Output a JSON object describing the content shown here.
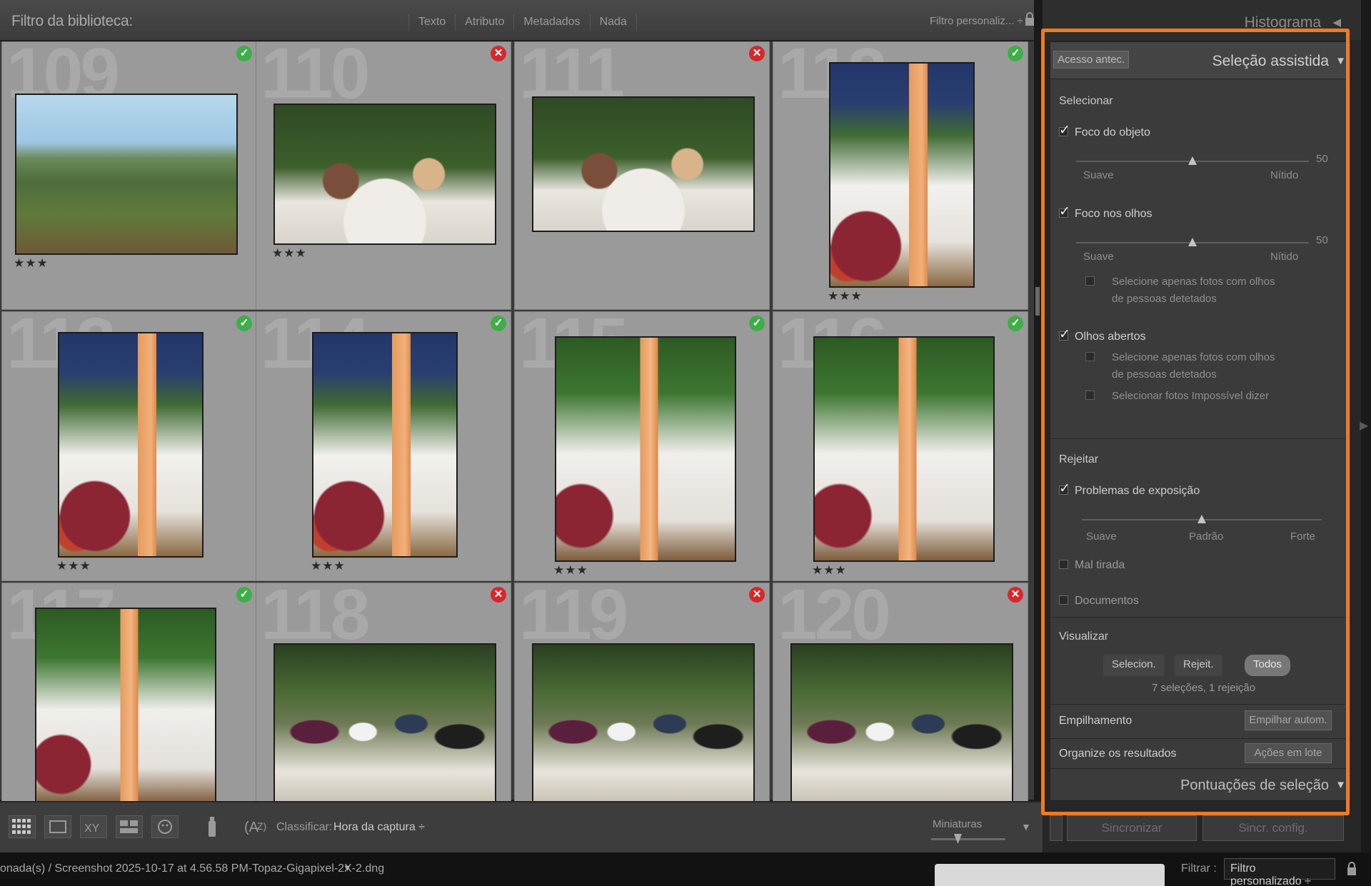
{
  "filterbar": {
    "title": "Filtro da biblioteca:",
    "tabs": [
      "Texto",
      "Atributo",
      "Metadados",
      "Nada"
    ],
    "preset": "Filtro personaliz... ÷"
  },
  "grid": {
    "cells": [
      {
        "num": "109",
        "flag": "pick",
        "stars": "★★★",
        "scene": "vineyard"
      },
      {
        "num": "110",
        "flag": "reject",
        "stars": "★★★",
        "scene": "table"
      },
      {
        "num": "111",
        "flag": "reject",
        "stars": "",
        "scene": "table"
      },
      {
        "num": "112",
        "flag": "pick",
        "stars": "★★★",
        "scene": "bottle"
      },
      {
        "num": "113",
        "flag": "pick",
        "stars": "★★★",
        "scene": "bottle"
      },
      {
        "num": "114",
        "flag": "pick",
        "stars": "★★★",
        "scene": "bottle"
      },
      {
        "num": "115",
        "flag": "pick",
        "stars": "★★★",
        "scene": "bottle2"
      },
      {
        "num": "116",
        "flag": "pick",
        "stars": "★★★",
        "scene": "bottle2"
      },
      {
        "num": "117",
        "flag": "pick",
        "stars": "",
        "scene": "bottle2"
      },
      {
        "num": "118",
        "flag": "reject",
        "stars": "",
        "scene": "group"
      },
      {
        "num": "119",
        "flag": "reject",
        "stars": "",
        "scene": "group"
      },
      {
        "num": "120",
        "flag": "reject",
        "stars": "",
        "scene": "group"
      }
    ]
  },
  "toolbar": {
    "sort_label": "Classificar:",
    "sort_value": "Hora da captura ÷",
    "thumbnails_label": "Miniaturas"
  },
  "panel": {
    "histogram_title": "Histograma",
    "peek_button": "Acesso antec.",
    "assist_title": "Seleção assistida",
    "select": {
      "label": "Selecionar",
      "subject_focus": "Foco do objeto",
      "subject_value": "50",
      "subject_level": 0.5,
      "soft": "Suave",
      "sharp": "Nítido",
      "eye_focus": "Foco nos olhos",
      "eye_value": "50",
      "eye_level": 0.5,
      "eye_only_detected": "Selecione apenas fotos com olhos de pessoas detetados",
      "eyes_open": "Olhos abertos",
      "open_only_detected": "Selecione apenas fotos com olhos de pessoas detetados",
      "cant_tell": "Selecionar fotos Impossível dizer"
    },
    "reject": {
      "label": "Rejeitar",
      "exposure": "Problemas de exposição",
      "soft": "Suave",
      "standard": "Padrão",
      "strong": "Forte",
      "exposure_level": 0.5,
      "bad_shot": "Mal tirada",
      "documents": "Documentos"
    },
    "view": {
      "label": "Visualizar",
      "picks": "Selecion.",
      "rejects": "Rejeit.",
      "all": "Todos",
      "summary": "7 seleções, 1 rejeição"
    },
    "stacking_label": "Empilhamento",
    "auto_stack": "Empilhar autom.",
    "organize_label": "Organize os resultados",
    "batch_actions": "Ações em lote",
    "scores_title": "Pontuações de seleção",
    "sync": "Sincronizar",
    "sync_settings": "Sincr. config."
  },
  "status": {
    "path": "onada(s) / Screenshot 2025-10-17 at 4.56.58 PM-Topaz-Gigapixel-2X-2.dng",
    "filter_label": "Filtrar :",
    "filter_value": "Filtro personalizado ÷"
  },
  "colors": {
    "highlight": "#f07a20",
    "pick": "#3fae49",
    "reject": "#d8272c"
  }
}
